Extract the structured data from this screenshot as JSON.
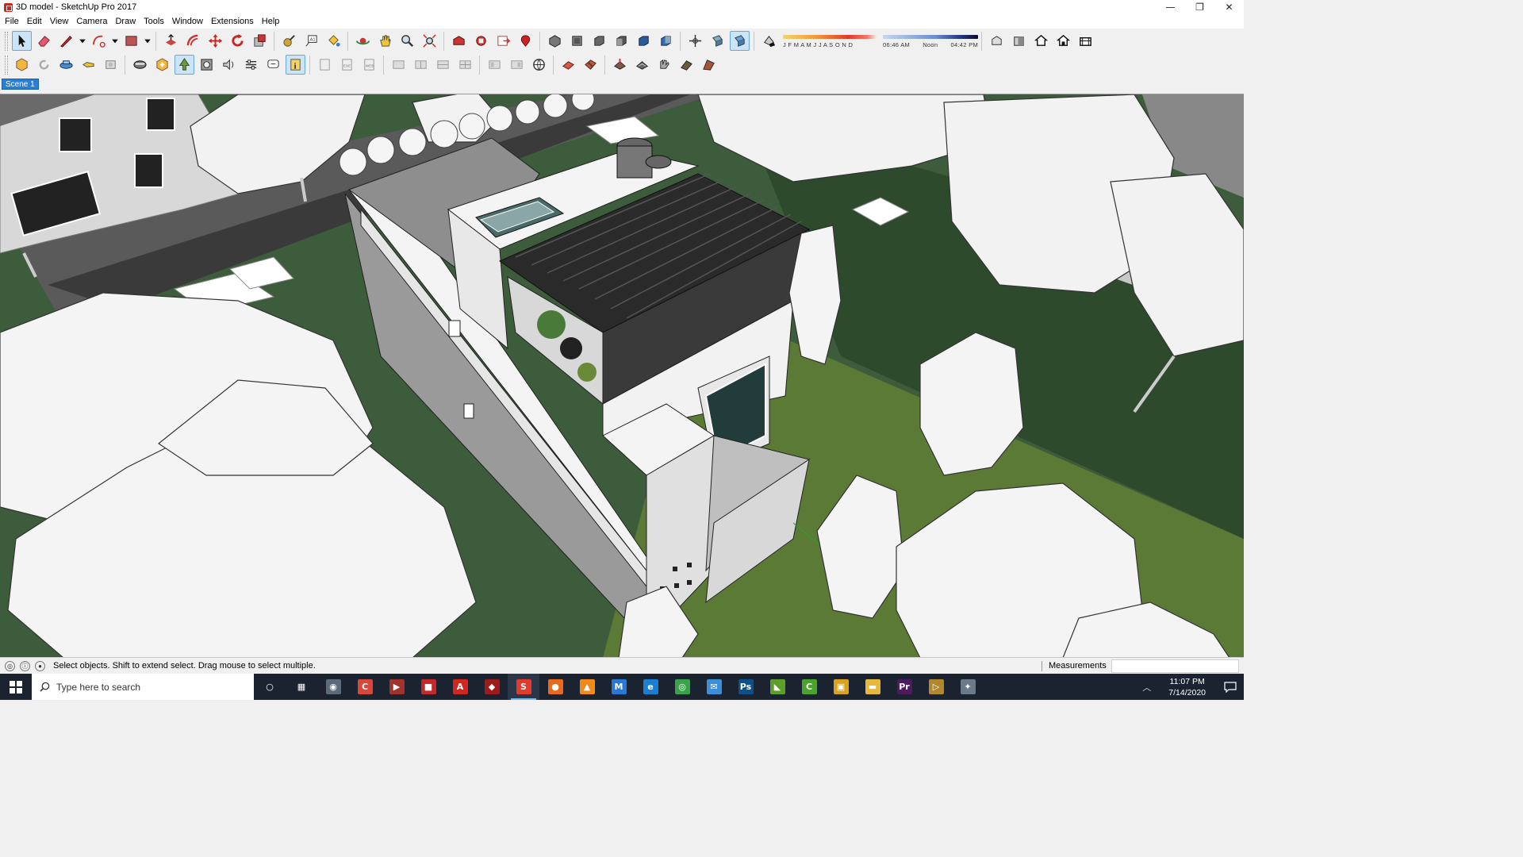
{
  "window": {
    "title": "3D model - SketchUp Pro 2017",
    "controls": {
      "minimize": "—",
      "maximize": "❐",
      "close": "✕"
    }
  },
  "menu": [
    "File",
    "Edit",
    "View",
    "Camera",
    "Draw",
    "Tools",
    "Window",
    "Extensions",
    "Help"
  ],
  "toolbar": {
    "row1": [
      "select-icon",
      "eraser-icon",
      "pencil-line-icon",
      "dropdown-arrow-icon",
      "arc-icon",
      "dropdown-arrow-icon",
      "rectangle-icon",
      "dropdown-arrow-icon",
      "push-pull-icon",
      "offset-icon",
      "move-icon",
      "rotate-icon",
      "scale-icon",
      "tape-measure-icon",
      "text-icon",
      "paint-bucket-icon",
      "orbit-icon",
      "pan-icon",
      "zoom-icon",
      "zoom-extents-icon",
      "warehouse-icon",
      "extension-warehouse-icon",
      "layout-icon",
      "extension-manager-icon",
      "iso-view-icon",
      "top-view-icon",
      "front-view-icon",
      "right-view-icon",
      "back-view-icon",
      "left-view-icon",
      "axes-icon",
      "section-plane-icon",
      "section-display-icon",
      "shadows-toggle-icon",
      "x-ray-icon",
      "wireframe-icon",
      "hidden-line-icon",
      "shaded-icon",
      "textured-icon",
      "monochrome-icon"
    ],
    "shadow_months": "J F M A M J J A S O N D",
    "shadow_time_start": "06:46 AM",
    "shadow_time_mid": "Noon",
    "shadow_time_end": "04:42 PM",
    "row2": [
      "sandbox-icon",
      "refresh-icon",
      "shapes-icon",
      "camera-icon",
      "print-icon",
      "add-location-icon",
      "tree-icon",
      "render-icon",
      "sound-icon",
      "settings-icon",
      "comment-icon",
      "info-icon",
      "export-icon",
      "import-icon",
      "web-icon",
      "grid-icon",
      "panel-icon",
      "globe-icon",
      "stamp-icon",
      "drape-icon",
      "smoove-icon",
      "flip-edge-icon",
      "add-detail-icon"
    ]
  },
  "scene": {
    "tab_label": "Scene 1"
  },
  "status": {
    "message": "Select objects. Shift to extend select. Drag mouse to select multiple.",
    "measurements_label": "Measurements",
    "measurements_value": ""
  },
  "taskbar": {
    "search_placeholder": "Type here to search",
    "time": "11:07 PM",
    "date": "7/14/2020",
    "apps": [
      {
        "name": "cortana-icon",
        "glyph": "○",
        "color": "#1b2330"
      },
      {
        "name": "task-view-icon",
        "glyph": "▦",
        "color": "#1b2330"
      },
      {
        "name": "camera-app-icon",
        "glyph": "◉",
        "color": "#5c6b7a"
      },
      {
        "name": "app-red-c-icon",
        "glyph": "C",
        "color": "#d9473a"
      },
      {
        "name": "media-player-icon",
        "glyph": "▶",
        "color": "#a0342c"
      },
      {
        "name": "app-red-box-icon",
        "glyph": "■",
        "color": "#c4282b"
      },
      {
        "name": "adobe-acrobat-icon",
        "glyph": "A",
        "color": "#d1271e"
      },
      {
        "name": "app-dark-red-icon",
        "glyph": "◆",
        "color": "#9e1b1b"
      },
      {
        "name": "sketchup-icon",
        "glyph": "S",
        "color": "#e03b2c"
      },
      {
        "name": "firefox-icon",
        "glyph": "●",
        "color": "#ea6a1d"
      },
      {
        "name": "vlc-icon",
        "glyph": "▲",
        "color": "#f08a1c"
      },
      {
        "name": "app-blue-m-icon",
        "glyph": "M",
        "color": "#2a78d6"
      },
      {
        "name": "edge-icon",
        "glyph": "e",
        "color": "#1a7fd2"
      },
      {
        "name": "chrome-icon",
        "glyph": "◎",
        "color": "#3aa34a"
      },
      {
        "name": "mail-icon",
        "glyph": "✉",
        "color": "#3c8ed6"
      },
      {
        "name": "photoshop-icon",
        "glyph": "Ps",
        "color": "#0f4f8a"
      },
      {
        "name": "nvidia-icon",
        "glyph": "◣",
        "color": "#5e9e2a"
      },
      {
        "name": "app-green-c-icon",
        "glyph": "C",
        "color": "#4ca32b"
      },
      {
        "name": "store-icon",
        "glyph": "▣",
        "color": "#d9a21b"
      },
      {
        "name": "file-explorer-icon",
        "glyph": "▬",
        "color": "#e5b93d"
      },
      {
        "name": "premiere-icon",
        "glyph": "Pr",
        "color": "#4c1b5e"
      },
      {
        "name": "app-media-icon",
        "glyph": "▷",
        "color": "#b2882e"
      },
      {
        "name": "app-settings-icon",
        "glyph": "✦",
        "color": "#6a7a8a"
      }
    ]
  }
}
